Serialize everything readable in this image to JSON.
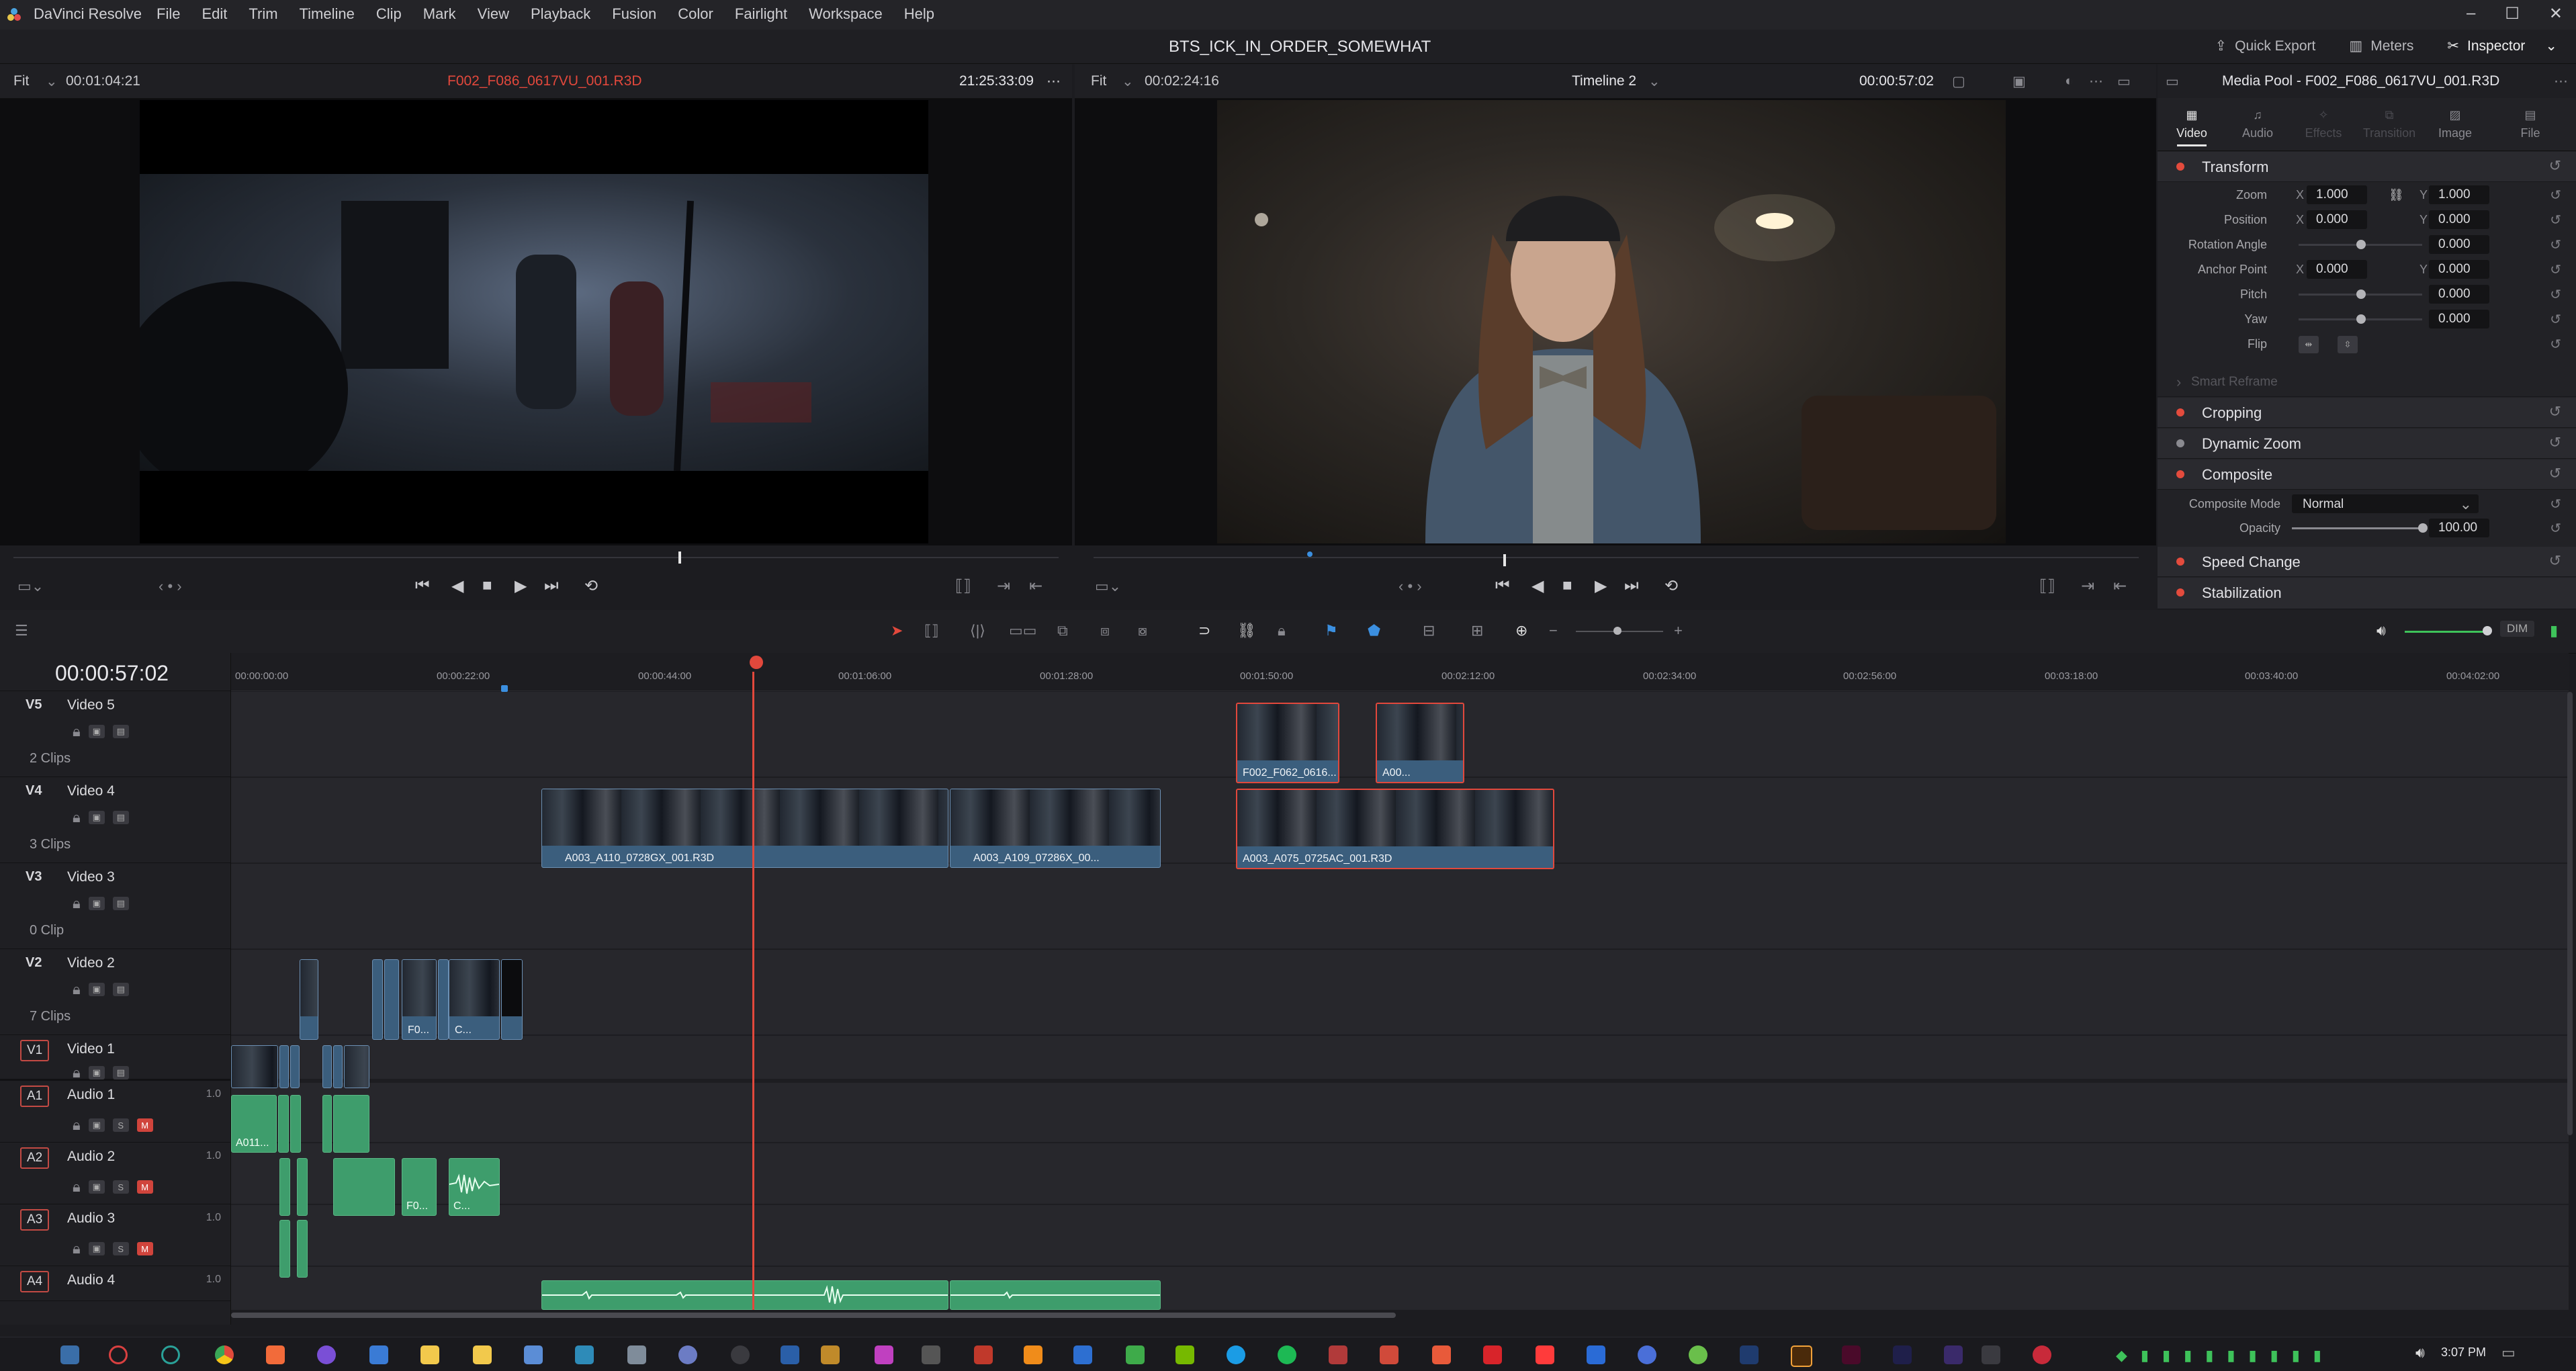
{
  "menubar": {
    "app_name": "DaVinci Resolve",
    "menus": [
      "File",
      "Edit",
      "Trim",
      "Timeline",
      "Clip",
      "Mark",
      "View",
      "Playback",
      "Fusion",
      "Color",
      "Fairlight",
      "Workspace",
      "Help"
    ]
  },
  "titlebar": {
    "project_title": "BTS_ICK_IN_ORDER_SOMEWHAT",
    "quick_export": "Quick Export",
    "meters": "Meters",
    "inspector": "Inspector"
  },
  "source_viewer": {
    "fit": "Fit",
    "timecode_left": "00:01:04:21",
    "clip_name": "F002_F086_0617VU_001.R3D",
    "timecode_right": "21:25:33:09"
  },
  "timeline_viewer": {
    "fit": "Fit",
    "timecode_left": "00:02:24:16",
    "timeline_name": "Timeline 2",
    "timecode_right": "00:00:57:02"
  },
  "inspector": {
    "header": "Media Pool - F002_F086_0617VU_001.R3D",
    "tabs": [
      "Video",
      "Audio",
      "Effects",
      "Transition",
      "Image",
      "File"
    ],
    "transform": {
      "title": "Transform",
      "zoom_label": "Zoom",
      "zoom_x": "1.000",
      "zoom_y": "1.000",
      "position_label": "Position",
      "pos_x": "0.000",
      "pos_y": "0.000",
      "rotation_label": "Rotation Angle",
      "rotation": "0.000",
      "anchor_label": "Anchor Point",
      "anchor_x": "0.000",
      "anchor_y": "0.000",
      "pitch_label": "Pitch",
      "pitch": "0.000",
      "yaw_label": "Yaw",
      "yaw": "0.000",
      "flip_label": "Flip",
      "x": "X",
      "y": "Y"
    },
    "smart_reframe": "Smart Reframe",
    "cropping": "Cropping",
    "dynamic_zoom": "Dynamic Zoom",
    "composite": {
      "title": "Composite",
      "mode_label": "Composite Mode",
      "mode": "Normal",
      "opacity_label": "Opacity",
      "opacity": "100.00"
    },
    "speed_change": "Speed Change",
    "stabilization": "Stabilization"
  },
  "timeline": {
    "timecode": "00:00:57:02",
    "dim": "DIM",
    "ruler": [
      "00:00:00:00",
      "00:00:22:00",
      "00:00:44:00",
      "00:01:06:00",
      "00:01:28:00",
      "00:01:50:00",
      "00:02:12:00",
      "00:02:34:00",
      "00:02:56:00",
      "00:03:18:00",
      "00:03:40:00",
      "00:04:02:00"
    ],
    "tracks": [
      {
        "id": "V5",
        "name": "Video 5",
        "count": "2 Clips"
      },
      {
        "id": "V4",
        "name": "Video 4",
        "count": "3 Clips"
      },
      {
        "id": "V3",
        "name": "Video 3",
        "count": "0 Clip"
      },
      {
        "id": "V2",
        "name": "Video 2",
        "count": "7 Clips"
      },
      {
        "id": "V1",
        "name": "Video 1",
        "count": ""
      },
      {
        "id": "A1",
        "name": "Audio 1",
        "level": "1.0"
      },
      {
        "id": "A2",
        "name": "Audio 2",
        "level": "1.0"
      },
      {
        "id": "A3",
        "name": "Audio 3",
        "level": "1.0"
      },
      {
        "id": "A4",
        "name": "Audio 4",
        "level": "1.0"
      }
    ],
    "clips": {
      "v5a": "F002_F062_0616...",
      "v5b": "A00...",
      "v4a": "A003_A110_0728GX_001.R3D",
      "v4b": "A003_A109_07286X_00...",
      "v4c": "A003_A075_0725AC_001.R3D",
      "v2a": "F0...",
      "v2b": "C...",
      "a1a": "A011...",
      "a2a": "F0...",
      "a2b": "C..."
    },
    "solo": "S",
    "mute": "M"
  },
  "taskbar": {
    "time": "3:07 PM"
  },
  "colors": {
    "accent_red": "#e2483c",
    "video_clip": "#3b5e7d",
    "audio_clip": "#3e9d6c",
    "playhead": "#e2483c"
  }
}
